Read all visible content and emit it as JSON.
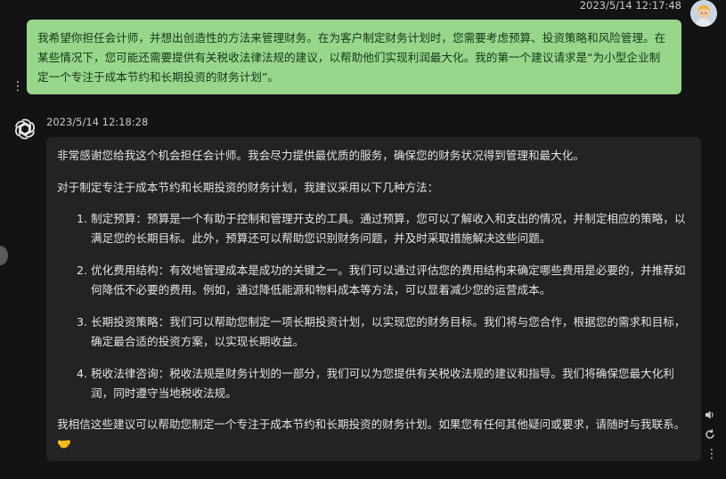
{
  "user_message": {
    "timestamp": "2023/5/14 12:17:48",
    "text": "我希望你担任会计师，并想出创造性的方法来管理财务。在为客户制定财务计划时，您需要考虑预算、投资策略和风险管理。在某些情况下，您可能还需要提供有关税收法律法规的建议，以帮助他们实现利润最大化。我的第一个建议请求是“为小型企业制定一个专注于成本节约和长期投资的财务计划”。"
  },
  "ai_message": {
    "timestamp": "2023/5/14 12:18:28",
    "intro": "非常感谢您给我这个机会担任会计师。我会尽力提供最优质的服务，确保您的财务状况得到管理和最大化。",
    "lead": "对于制定专注于成本节约和长期投资的财务计划，我建议采用以下几种方法：",
    "items": [
      "制定预算：预算是一个有助于控制和管理开支的工具。通过预算，您可以了解收入和支出的情况，并制定相应的策略，以满足您的长期目标。此外，预算还可以帮助您识别财务问题，并及时采取措施解决这些问题。",
      "优化费用结构：有效地管理成本是成功的关键之一。我们可以通过评估您的费用结构来确定哪些费用是必要的，并推荐如何降低不必要的费用。例如，通过降低能源和物料成本等方法，可以显着减少您的运营成本。",
      "长期投资策略：我们可以帮助您制定一项长期投资计划，以实现您的财务目标。我们将与您合作，根据您的需求和目标，确定最合适的投资方案，以实现长期收益。",
      "税收法律咨询：税收法规是财务计划的一部分，我们可以为您提供有关税收法规的建议和指导。我们将确保您最大化利润，同时遵守当地税收法规。"
    ],
    "closing": "我相信这些建议可以帮助您制定一个专注于成本节约和长期投资的财务计划。如果您有任何其他疑问或要求，请随时与我联系。",
    "closing_emoji": "🤝"
  },
  "icons": {
    "user_avatar": "user-avatar-icon",
    "ai_avatar": "openai-logo-icon",
    "more": "more-vertical-icon",
    "speaker": "speaker-icon",
    "refresh": "refresh-icon"
  },
  "colors": {
    "background": "#131316",
    "user_bubble": "#98d78b",
    "ai_bubble": "#232326"
  }
}
